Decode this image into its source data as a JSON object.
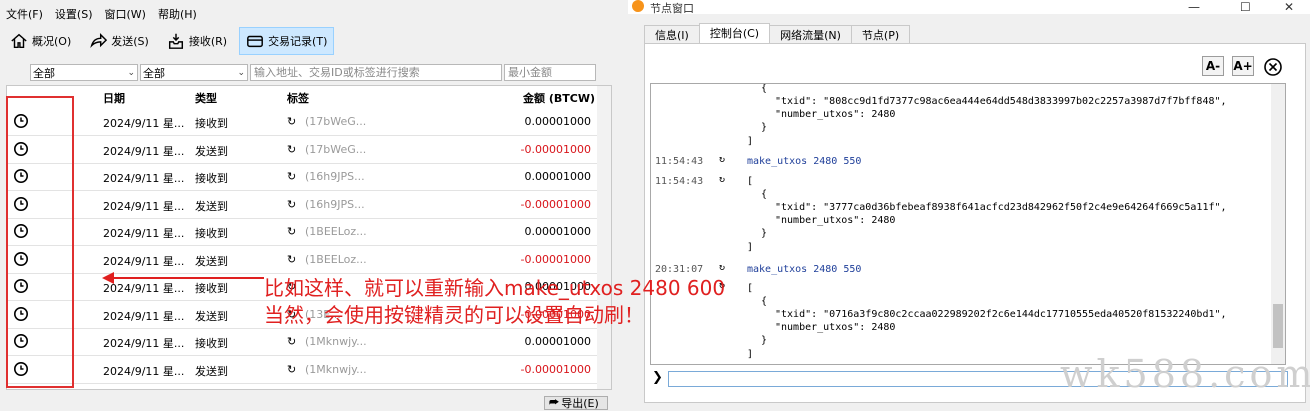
{
  "left_window": {
    "menu": [
      "文件(F)",
      "设置(S)",
      "窗口(W)",
      "帮助(H)"
    ],
    "toolbar": {
      "overview": "概况(O)",
      "send": "发送(S)",
      "receive": "接收(R)",
      "transactions": "交易记录(T)"
    },
    "filters": {
      "date_filter": "全部",
      "type_filter": "全部",
      "search_placeholder": "输入地址、交易ID或标签进行搜索",
      "min_amount_placeholder": "最小金额"
    },
    "table": {
      "headers": {
        "date": "日期",
        "type": "类型",
        "label": "标签",
        "amount": "金额 (BTCW)"
      },
      "rows": [
        {
          "date": "2024/9/11 星...",
          "type": "接收到",
          "label": "(17bWeG...",
          "amount": "0.00001000",
          "negative": false
        },
        {
          "date": "2024/9/11 星...",
          "type": "发送到",
          "label": "(17bWeG...",
          "amount": "-0.00001000",
          "negative": true
        },
        {
          "date": "2024/9/11 星...",
          "type": "接收到",
          "label": "(16h9JPS...",
          "amount": "0.00001000",
          "negative": false
        },
        {
          "date": "2024/9/11 星...",
          "type": "发送到",
          "label": "(16h9JPS...",
          "amount": "-0.00001000",
          "negative": true
        },
        {
          "date": "2024/9/11 星...",
          "type": "接收到",
          "label": "(1BEELoz...",
          "amount": "0.00001000",
          "negative": false
        },
        {
          "date": "2024/9/11 星...",
          "type": "发送到",
          "label": "(1BEELoz...",
          "amount": "-0.00001000",
          "negative": true
        },
        {
          "date": "2024/9/11 星...",
          "type": "接收到",
          "label": "",
          "amount": "0.00001000",
          "negative": false
        },
        {
          "date": "2024/9/11 星...",
          "type": "发送到",
          "label": "(13E...",
          "amount": "-0.00001000",
          "negative": true
        },
        {
          "date": "2024/9/11 星...",
          "type": "接收到",
          "label": "(1Mknwjy...",
          "amount": "0.00001000",
          "negative": false
        },
        {
          "date": "2024/9/11 星...",
          "type": "发送到",
          "label": "(1Mknwjy...",
          "amount": "-0.00001000",
          "negative": true
        }
      ]
    },
    "export_label": "导出(E)",
    "annotation_line1": "比如这样、就可以重新输入make_utxos 2480 600",
    "annotation_line2": "当然，会使用按键精灵的可以设置自动刷！"
  },
  "right_window": {
    "title": "节点窗口",
    "tabs": [
      "信息(I)",
      "控制台(C)",
      "网络流量(N)",
      "节点(P)"
    ],
    "font_decrease": "A-",
    "font_increase": "A+",
    "console": {
      "block1": {
        "open_brace": "{",
        "txid_line": "\"txid\": \"808cc9d1fd7377c98ac6ea444e64dd548d3833997b02c2257a3987d7f7bff848\",",
        "utxos_line": "\"number_utxos\": 2480",
        "close_brace": "}",
        "close_bracket": "]"
      },
      "entry2": {
        "time": "11:54:43",
        "command": "make_utxos 2480 550"
      },
      "entry3": {
        "time": "11:54:43",
        "open_bracket": "[",
        "open_brace": "{",
        "txid_line": "\"txid\": \"3777ca0d36bfebeaf8938f641acfcd23d842962f50f2c4e9e64264f669c5a11f\",",
        "utxos_line": "\"number_utxos\": 2480",
        "close_brace": "}",
        "close_bracket": "]"
      },
      "entry4": {
        "time": "20:31:07",
        "command": "make_utxos 2480 550"
      },
      "entry5": {
        "open_bracket": "[",
        "open_brace": "{",
        "txid_line": "\"txid\": \"0716a3f9c80c2ccaa022989202f2c6e144dc17710555eda40520f81532240bd1\",",
        "utxos_line": "\"number_utxos\": 2480",
        "close_brace": "}",
        "close_bracket": "]"
      }
    },
    "prompt_symbol": "❯"
  },
  "watermark": "wk588.com",
  "colors": {
    "annotation": "#e02020",
    "negative_amount": "#d8141a",
    "active_tab": "#cde8ff"
  }
}
